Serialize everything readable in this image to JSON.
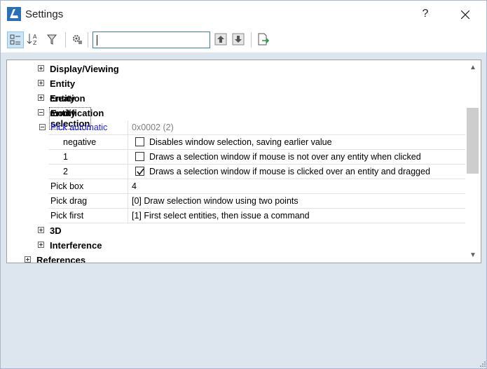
{
  "window": {
    "title": "Settings",
    "help_label": "?",
    "colors": {
      "accent": "#3c7fb1",
      "link_blue": "#1a1aff",
      "grey_value": "#808080",
      "background": "#dde6ef"
    }
  },
  "toolbar": {
    "buttons": [
      "categorized-view-icon",
      "alphabetical-sort-icon",
      "filter-icon",
      "settings-tools-icon",
      "search-previous-icon",
      "search-next-icon",
      "export-icon"
    ],
    "search_value": ""
  },
  "tree": {
    "display_viewing": "Display/Viewing",
    "entity_creation": "Entity creation",
    "entity_modification": "Entity modification",
    "entity_selection": "Entity selection",
    "pick_automatic": {
      "name": "Pick automatic",
      "value": "0x0002 (2)"
    },
    "bits": [
      {
        "name": "negative",
        "checked": false,
        "text": "Disables window selection, saving earlier value"
      },
      {
        "name": "1",
        "checked": false,
        "text": "Draws a selection window if mouse is not over any entity when clicked"
      },
      {
        "name": "2",
        "checked": true,
        "text": "Draws a selection window if mouse is clicked over an entity and dragged"
      }
    ],
    "pick_box": {
      "name": "Pick box",
      "value": "4"
    },
    "pick_drag": {
      "name": "Pick drag",
      "value": "[0] Draw selection window using two points"
    },
    "pick_first": {
      "name": "Pick first",
      "value": "[1] First select entities, then issue a command"
    },
    "three_d": "3D",
    "interference": "Interference",
    "references": "References"
  }
}
